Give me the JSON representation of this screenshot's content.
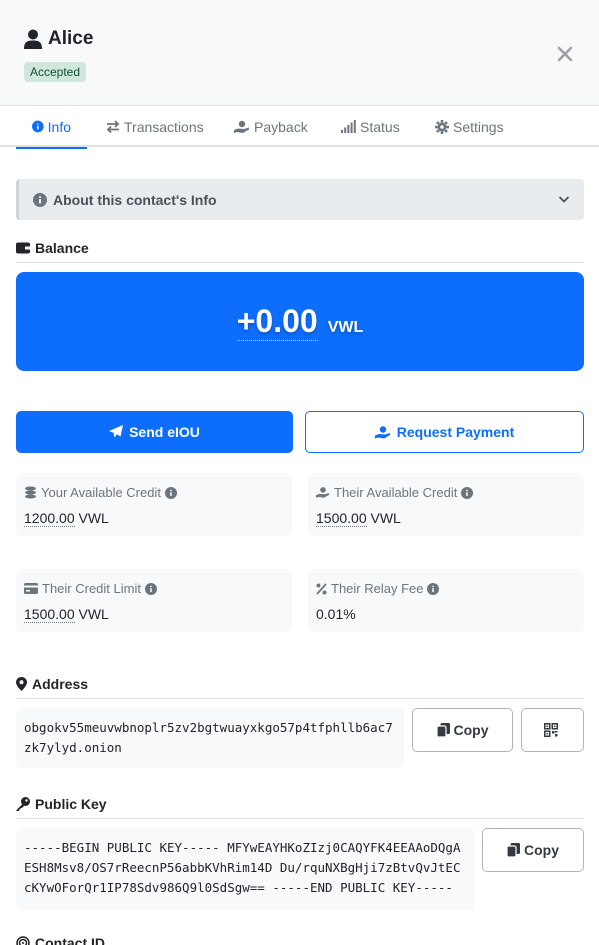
{
  "contact": {
    "name": "Alice",
    "status": "Accepted"
  },
  "tabs": [
    {
      "label": "Info",
      "icon": "info-circle-icon"
    },
    {
      "label": "Transactions",
      "icon": "exchange-arrows-icon"
    },
    {
      "label": "Payback",
      "icon": "hand-holding-dollar-icon"
    },
    {
      "label": "Status",
      "icon": "signal-bars-icon"
    },
    {
      "label": "Settings",
      "icon": "gear-icon"
    }
  ],
  "about": {
    "label": "About this contact's Info"
  },
  "balance": {
    "title": "Balance",
    "amount": "+0.00",
    "unit": "VWL"
  },
  "actions": {
    "send": "Send eIOU",
    "request": "Request Payment"
  },
  "stats": [
    {
      "label": "Your Available Credit",
      "value": "1200.00",
      "unit": "VWL",
      "icon": "coins-icon"
    },
    {
      "label": "Their Available Credit",
      "value": "1500.00",
      "unit": "VWL",
      "icon": "hand-holding-dollar-icon"
    },
    {
      "label": "Their Credit Limit",
      "value": "1500.00",
      "unit": "VWL",
      "icon": "credit-card-icon"
    },
    {
      "label": "Their Relay Fee",
      "value": "0.01%",
      "unit": "",
      "icon": "percent-icon"
    }
  ],
  "address": {
    "title": "Address",
    "value": "obgokv55meuvwbnoplr5zv2bgtwuayxkgo57p4tfphllb6ac7zk7ylyd.onion",
    "copy_label": "Copy"
  },
  "public_key": {
    "title": "Public Key",
    "value": "-----BEGIN PUBLIC KEY----- MFYwEAYHKoZIzj0CAQYFK4EEAAoDQgAESH8Msv8/OS7rReecnP56abbKVhRim14D Du/rquNXBgHji7zBtvQvJtECcKYwOForQr1IP78Sdv986Q9l0SdSgw== -----END PUBLIC KEY-----",
    "copy_label": "Copy"
  },
  "contact_id": {
    "title": "Contact ID"
  },
  "colors": {
    "primary": "#0d6efd",
    "badge_bg": "#d1e7dd",
    "badge_text": "#0f5132",
    "muted": "#6c757d"
  }
}
